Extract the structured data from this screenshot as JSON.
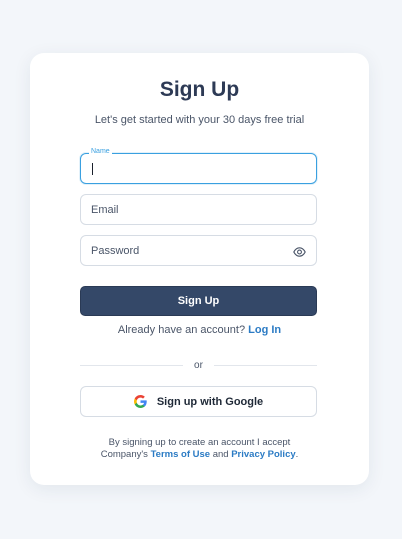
{
  "form": {
    "title": "Sign Up",
    "subtitle": "Let's get started with your 30 days free trial",
    "name_label": "Name",
    "email_placeholder": "Email",
    "password_placeholder": "Password",
    "submit_label": "Sign Up",
    "have_account_text": "Already have an account?",
    "login_link": "Log In",
    "divider_text": "or",
    "google_label": "Sign up with Google",
    "terms_line1": "By signing up to create an account I accept",
    "terms_prefix": "Company's",
    "terms_of_use": "Terms of Use",
    "terms_and": "and",
    "privacy_policy": "Privacy Policy",
    "terms_suffix": "."
  },
  "icons": {
    "show_password": "eye-icon",
    "google": "google-logo-icon"
  },
  "colors": {
    "primary_button": "#344868",
    "link": "#2b7bc4",
    "focus": "#3aa0e0",
    "background": "#f3f6fa"
  }
}
